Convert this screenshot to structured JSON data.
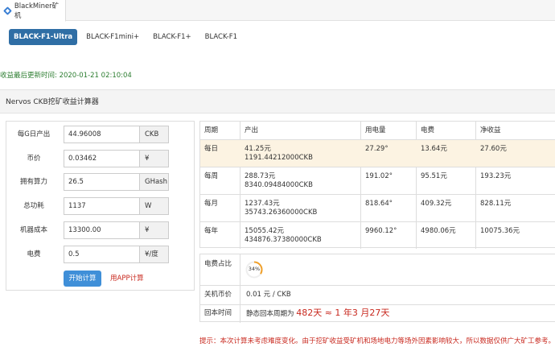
{
  "browser_tab": {
    "title": "BlackMiner矿机"
  },
  "models": [
    "BLACK-F1-Ultra",
    "BLACK-F1mini+",
    "BLACK-F1+",
    "BLACK-F1"
  ],
  "update_text": "收益最后更新时间: 2020-01-21 02:10:04",
  "panel_title": "Nervos CKB挖矿收益计算器",
  "form": {
    "rows": [
      {
        "label": "每G日产出",
        "value": "44.96008",
        "unit": "CKB"
      },
      {
        "label": "币价",
        "value": "0.03462",
        "unit": "¥"
      },
      {
        "label": "拥有算力",
        "value": "26.5",
        "unit": "GHash"
      },
      {
        "label": "总功耗",
        "value": "1137",
        "unit": "W"
      },
      {
        "label": "机器成本",
        "value": "13300.00",
        "unit": "¥"
      },
      {
        "label": "电费",
        "value": "0.5",
        "unit": "¥/度"
      }
    ],
    "calc_button": "开始计算",
    "app_link": "用APP计算"
  },
  "results": {
    "headers": [
      "周期",
      "产出",
      "用电量",
      "电费",
      "净收益"
    ],
    "rows": [
      {
        "period": "每日",
        "yuan": "41.25元",
        "ckb": "1191.44212000CKB",
        "power": "27.29°",
        "cost": "13.64元",
        "net": "27.60元"
      },
      {
        "period": "每周",
        "yuan": "288.73元",
        "ckb": "8340.09484000CKB",
        "power": "191.02°",
        "cost": "95.51元",
        "net": "193.23元"
      },
      {
        "period": "每月",
        "yuan": "1237.43元",
        "ckb": "35743.26360000CKB",
        "power": "818.64°",
        "cost": "409.32元",
        "net": "828.11元"
      },
      {
        "period": "每年",
        "yuan": "15055.42元",
        "ckb": "434876.37380000CKB",
        "power": "9960.12°",
        "cost": "4980.06元",
        "net": "10075.36元"
      }
    ]
  },
  "summary": {
    "elec_label": "电费占比",
    "elec_percent": "34%",
    "elec_fraction": 0.34,
    "shutdown_label": "关机币价",
    "shutdown_value": "0.01 元 / CKB",
    "payback_label": "回本时间",
    "payback_prefix": "静态回本周期为",
    "payback_value": "482天 ≈ 1 年3 月27天"
  },
  "hint": "提示：本次计算未考虑难度变化。由于挖矿收益受矿机和场地电力等场外因素影响较大，所以数据仅供广大矿工参考。",
  "colors": {
    "accent": "#2f6ea5",
    "button": "#3f8fd8",
    "red": "#c8281e",
    "green": "#2c7d30",
    "highlight": "#fcf3e2",
    "gauge": "#f0a02a"
  }
}
